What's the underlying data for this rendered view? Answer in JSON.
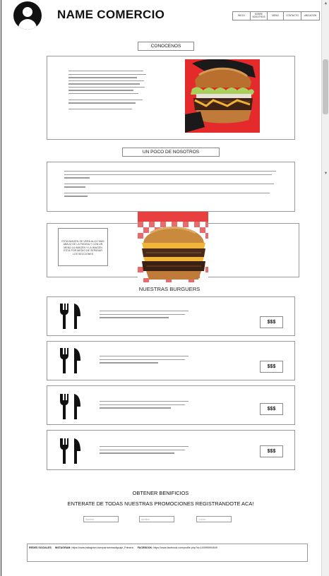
{
  "header": {
    "brand": "NAME COMERCIO",
    "nav": [
      {
        "label": "INICIO"
      },
      {
        "label": "SOBRE NOSOTROS"
      },
      {
        "label": "MENU"
      },
      {
        "label": "CONTACTO"
      },
      {
        "label": "UBICACION"
      }
    ]
  },
  "sections": {
    "conocenos_label": "CONOCENOS",
    "nosotros_label": "UN POCO DE NOSOTROS",
    "image_caption": "ESTA IMAGEN SE VERÁ ALGO MÁS ABAJO DE LA PÁGINA Y CON UN MENÚ LA IMAGEN Y LA IMAGEN ESTÁ POR MEDIO DE SEPARAR LOS SECCIONES",
    "burgers_title": "NUESTRAS BURGUERS"
  },
  "menu": {
    "items": [
      {
        "price": "$$$",
        "icon": "utensils-icon"
      },
      {
        "price": "$$$",
        "icon": "utensils-icon"
      },
      {
        "price": "$$$",
        "icon": "utensils-icon"
      },
      {
        "price": "$$$",
        "icon": "utensils-icon"
      }
    ]
  },
  "promo": {
    "title": "OBTENER BENIFICIOS",
    "subtitle": "ENTERATE DE TODAS NUESTRAS PROMOCIONES REGISTRANDOTE ACA!",
    "fields": [
      {
        "placeholder": "Nombre"
      },
      {
        "placeholder": "Apellido"
      },
      {
        "placeholder": "Correo"
      }
    ]
  },
  "footer": {
    "redes_label": "REDES SOCIALES",
    "instagram_label": "INSTAGRAM:",
    "instagram_url": "https://www.instagram.com/parrammacitguaje_Primera",
    "facebook_label": "FACEBOOK:",
    "facebook_url": "https://www.facebook.com/profile.php?id=100995994549"
  },
  "colors": {
    "accent_red": "#e52a2c",
    "border": "#999999"
  }
}
